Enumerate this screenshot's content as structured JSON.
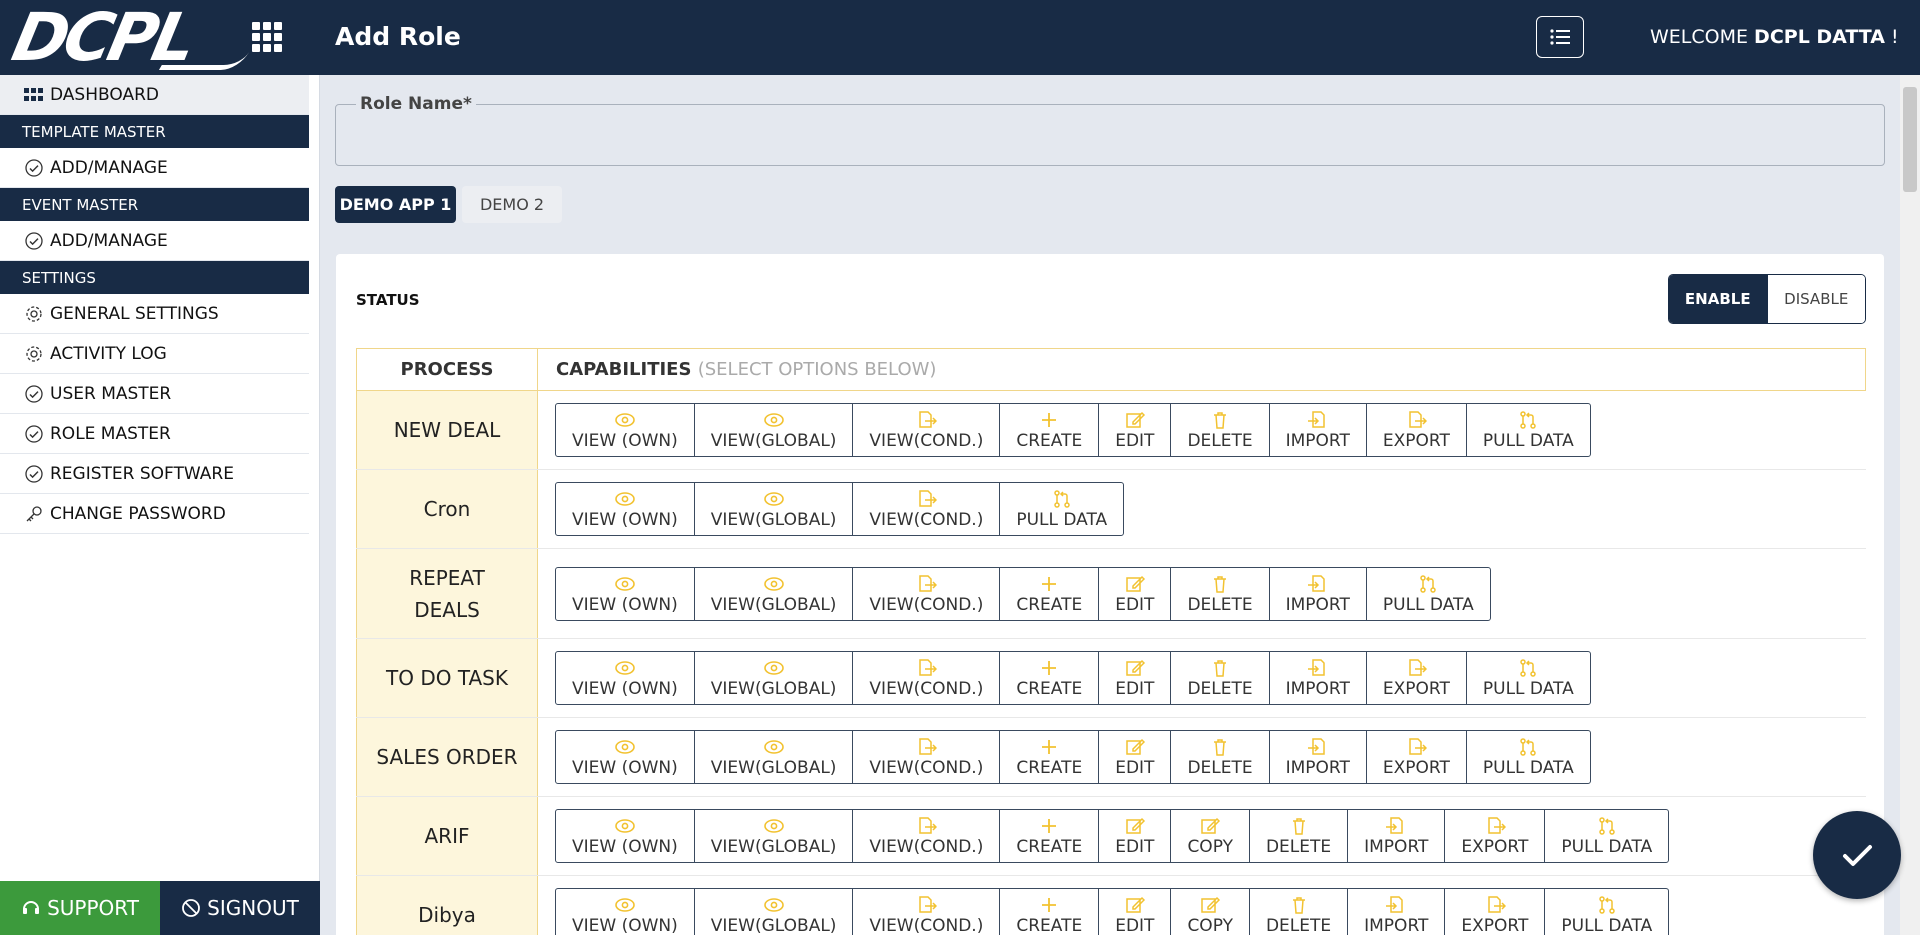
{
  "header": {
    "logo": "DCPL",
    "title": "Add Role",
    "welcome_prefix": "WELCOME",
    "welcome_user": "DCPL DATTA",
    "welcome_suffix": "!"
  },
  "sidebar": {
    "dashboard": "DASHBOARD",
    "sections": [
      {
        "heading": "TEMPLATE MASTER",
        "items": [
          "ADD/MANAGE"
        ]
      },
      {
        "heading": "EVENT MASTER",
        "items": [
          "ADD/MANAGE"
        ]
      },
      {
        "heading": "SETTINGS",
        "items": [
          "GENERAL SETTINGS",
          "ACTIVITY LOG",
          "USER MASTER",
          "ROLE MASTER",
          "REGISTER SOFTWARE",
          "CHANGE PASSWORD"
        ]
      }
    ],
    "support": "SUPPORT",
    "signout": "SIGNOUT"
  },
  "form": {
    "role_name_label": "Role Name*",
    "role_name_value": ""
  },
  "apps": {
    "tabs": [
      "DEMO APP 1",
      "DEMO 2"
    ],
    "active": "DEMO APP 1"
  },
  "status": {
    "label": "STATUS",
    "enable": "ENABLE",
    "disable": "DISABLE",
    "selected": "ENABLE"
  },
  "table": {
    "col_process": "PROCESS",
    "col_capabilities": "CAPABILITIES",
    "col_capabilities_hint": "(SELECT OPTIONS BELOW)",
    "rows": [
      {
        "process": "NEW DEAL",
        "capabilities": [
          "VIEW (OWN)",
          "VIEW(GLOBAL)",
          "VIEW(COND.)",
          "CREATE",
          "EDIT",
          "DELETE",
          "IMPORT",
          "EXPORT",
          "PULL DATA"
        ]
      },
      {
        "process": "Cron",
        "capabilities": [
          "VIEW (OWN)",
          "VIEW(GLOBAL)",
          "VIEW(COND.)",
          "PULL DATA"
        ]
      },
      {
        "process": "REPEAT DEALS",
        "capabilities": [
          "VIEW (OWN)",
          "VIEW(GLOBAL)",
          "VIEW(COND.)",
          "CREATE",
          "EDIT",
          "DELETE",
          "IMPORT",
          "PULL DATA"
        ]
      },
      {
        "process": "TO DO TASK",
        "capabilities": [
          "VIEW (OWN)",
          "VIEW(GLOBAL)",
          "VIEW(COND.)",
          "CREATE",
          "EDIT",
          "DELETE",
          "IMPORT",
          "EXPORT",
          "PULL DATA"
        ]
      },
      {
        "process": "SALES ORDER",
        "capabilities": [
          "VIEW (OWN)",
          "VIEW(GLOBAL)",
          "VIEW(COND.)",
          "CREATE",
          "EDIT",
          "DELETE",
          "IMPORT",
          "EXPORT",
          "PULL DATA"
        ]
      },
      {
        "process": "ARIF",
        "capabilities": [
          "VIEW (OWN)",
          "VIEW(GLOBAL)",
          "VIEW(COND.)",
          "CREATE",
          "EDIT",
          "COPY",
          "DELETE",
          "IMPORT",
          "EXPORT",
          "PULL DATA"
        ]
      },
      {
        "process": "Dibya",
        "capabilities": [
          "VIEW (OWN)",
          "VIEW(GLOBAL)",
          "VIEW(COND.)",
          "CREATE",
          "EDIT",
          "COPY",
          "DELETE",
          "IMPORT",
          "EXPORT",
          "PULL DATA"
        ]
      }
    ]
  },
  "colors": {
    "navy": "#182b45",
    "icon_gold": "#f2c230",
    "process_bg": "#fdf6dc",
    "support_green": "#3c9a3c"
  }
}
